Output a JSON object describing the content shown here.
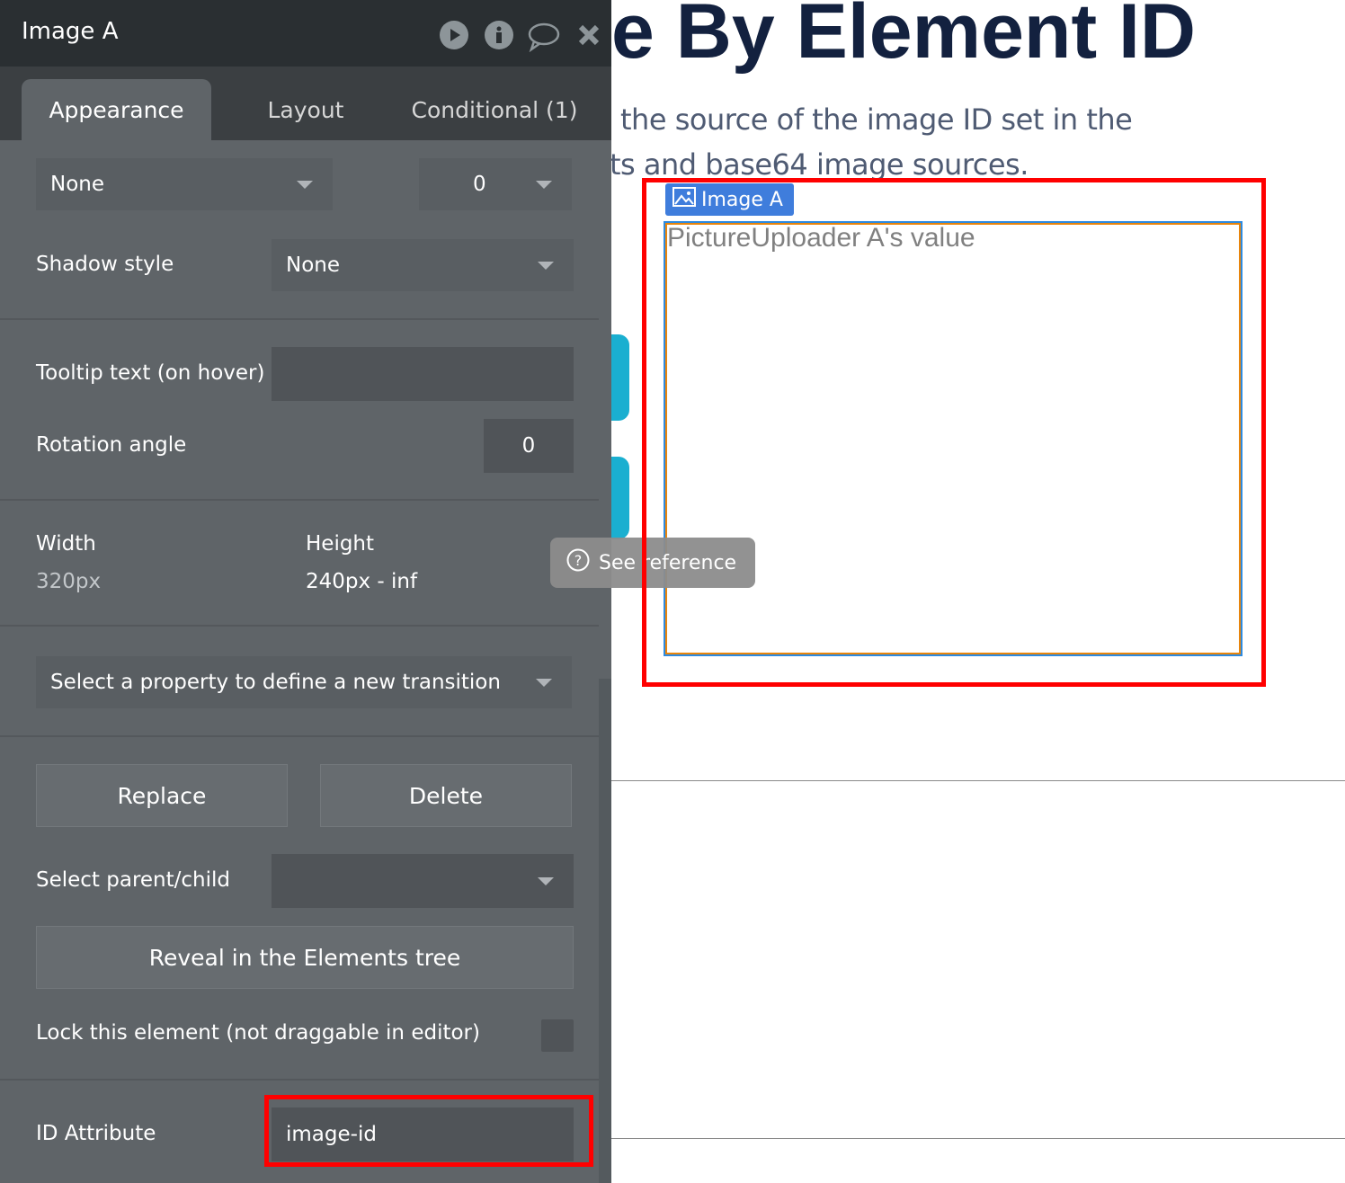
{
  "page": {
    "heading": "e By Element ID",
    "subtitle_line1": "the source of the image ID set in the",
    "subtitle_line2": "ts and base64 image sources.",
    "image_element": {
      "tag_label": "Image A",
      "placeholder": "PictureUploader A's value"
    },
    "see_reference": "See reference"
  },
  "panel": {
    "title": "Image A",
    "header_icons": [
      "play-icon",
      "info-icon",
      "comment-icon",
      "close-icon"
    ],
    "tabs": [
      {
        "label": "Appearance",
        "active": true
      },
      {
        "label": "Layout"
      },
      {
        "label": "Conditional (1)"
      }
    ],
    "border_style": "None",
    "border_width": "0",
    "shadow_style_label": "Shadow style",
    "shadow_style": "None",
    "tooltip_label": "Tooltip text (on hover)",
    "tooltip_value": "",
    "rotation_label": "Rotation angle",
    "rotation_value": "0",
    "width_label": "Width",
    "width_value": "320px",
    "height_label": "Height",
    "height_value": "240px - inf",
    "transition_placeholder": "Select a property to define a new transition",
    "replace": "Replace",
    "delete": "Delete",
    "parent_child_label": "Select parent/child",
    "parent_child_value": "",
    "reveal": "Reveal in the Elements tree",
    "lock_label": "Lock this element (not draggable in editor)",
    "lock_checked": false,
    "id_label": "ID Attribute",
    "id_value": "image-id"
  },
  "colors": {
    "highlight": "#ff0000",
    "tag": "#3f7ddc",
    "heading": "#13213f",
    "accent": "#1aafd0"
  }
}
